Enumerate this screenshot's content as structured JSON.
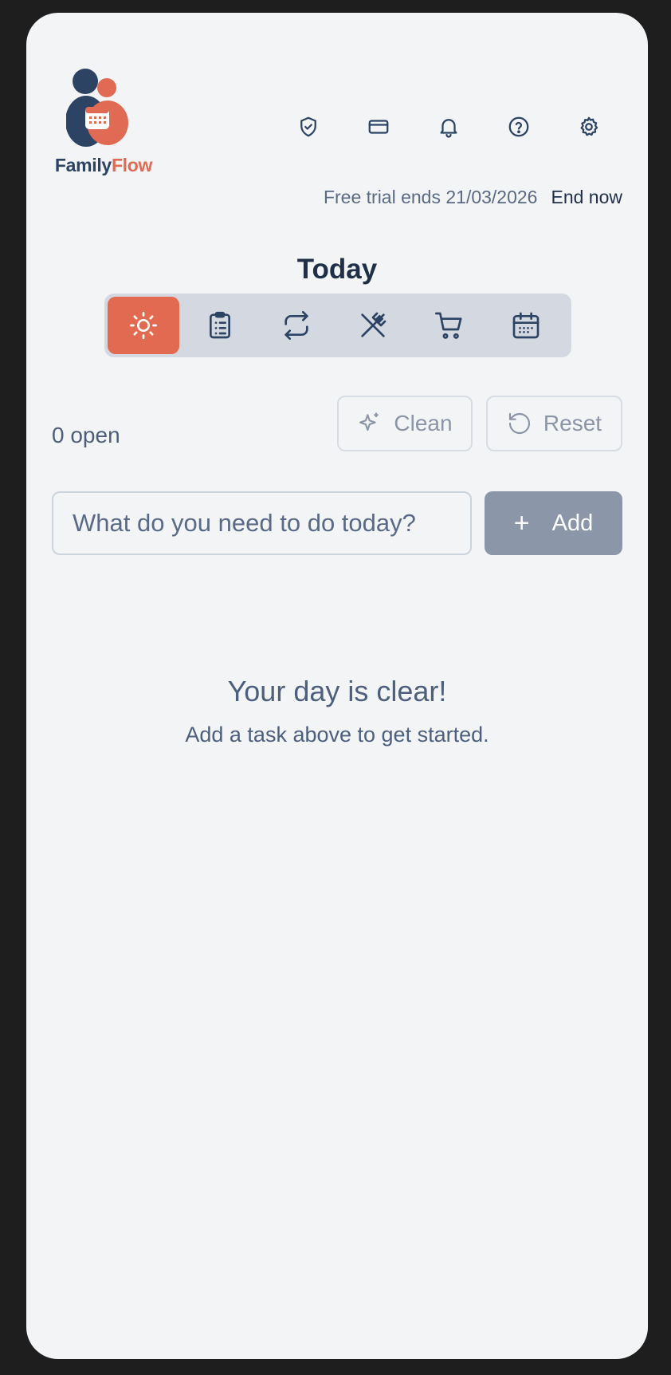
{
  "brand": {
    "name_part1": "Family",
    "name_part2": "Flow"
  },
  "header_icons": [
    {
      "name": "shield-check-icon"
    },
    {
      "name": "credit-card-icon"
    },
    {
      "name": "bell-icon"
    },
    {
      "name": "help-circle-icon"
    },
    {
      "name": "settings-gear-icon"
    }
  ],
  "trial": {
    "text": "Free trial ends 21/03/2026",
    "action": "End now"
  },
  "page": {
    "title": "Today"
  },
  "tabs": [
    {
      "icon": "sun-icon",
      "active": true
    },
    {
      "icon": "clipboard-list-icon",
      "active": false
    },
    {
      "icon": "repeat-icon",
      "active": false
    },
    {
      "icon": "utensils-crossed-icon",
      "active": false
    },
    {
      "icon": "shopping-cart-icon",
      "active": false
    },
    {
      "icon": "calendar-icon",
      "active": false
    }
  ],
  "toolbar": {
    "open_count": "0 open",
    "clean_label": "Clean",
    "reset_label": "Reset"
  },
  "task_input": {
    "placeholder": "What do you need to do today?",
    "value": "",
    "add_label": "Add"
  },
  "empty_state": {
    "title": "Your day is clear!",
    "subtitle": "Add a task above to get started."
  },
  "colors": {
    "accent": "#e26a50",
    "navy": "#2d4363",
    "background": "#f2f4f6",
    "add_button": "#8b97a8"
  }
}
